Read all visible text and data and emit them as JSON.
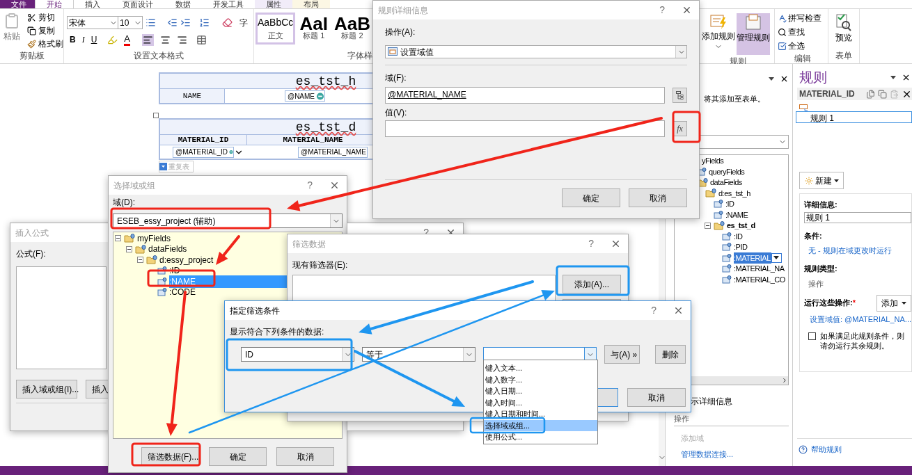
{
  "ribbon": {
    "tabs": [
      {
        "label": "文件",
        "kind": "file",
        "selected": false
      },
      {
        "label": "开始",
        "kind": "tab",
        "selected": true
      },
      {
        "label": "插入",
        "kind": "tab",
        "selected": false
      },
      {
        "label": "页面设计",
        "kind": "tab",
        "selected": false
      },
      {
        "label": "数据",
        "kind": "tab",
        "selected": false
      },
      {
        "label": "开发工具",
        "kind": "tab",
        "selected": false
      },
      {
        "label": "属性",
        "kind": "tab",
        "selected": false,
        "color": "#f1ecf9"
      },
      {
        "label": "布局",
        "kind": "tab",
        "selected": false,
        "color": "#fcf7e4"
      }
    ],
    "clipboard": {
      "paste": "粘贴",
      "cut": "剪切",
      "copy": "复制",
      "painter": "格式刷",
      "label": "剪贴板"
    },
    "format": {
      "font": "宋体",
      "size": "10",
      "bold": "B",
      "italic": "I",
      "underline": "U",
      "font_color": "A",
      "char": "字",
      "label": "设置文本格式"
    },
    "styles": {
      "items": [
        {
          "preview": "AaBbCc",
          "name": "正文",
          "selected": true
        },
        {
          "preview": "AaI",
          "name": "标题 1",
          "selected": false
        },
        {
          "preview": "AaB",
          "name": "标题 2",
          "selected": false
        }
      ],
      "label": "字体样"
    },
    "rules": {
      "add": "添加规则",
      "manage": "管理规则",
      "manage_selected": true,
      "label": "规则"
    },
    "editing": {
      "spell": "拼写检查",
      "find": "查找",
      "select_all": "全选",
      "label": "编辑"
    },
    "form": {
      "preview": "预览",
      "label": "表单"
    }
  },
  "canvas": {
    "header_table": {
      "title": "es_tst_h",
      "label": "NAME",
      "field": "@NAME"
    },
    "repeating_table": {
      "title": "es_tst_d",
      "columns": [
        "MATERIAL_ID",
        "MATERIAL_NAME"
      ],
      "fields": [
        "@MATERIAL_ID",
        "@MATERIAL_NAME"
      ],
      "tag": "重复表"
    }
  },
  "fields_panel": {
    "hint": "将其添加至表单。",
    "tree": [
      {
        "label": "yFields",
        "selected": false,
        "children": [
          {
            "label": "queryFields",
            "selected": false
          },
          {
            "label": "dataFields",
            "selected": false,
            "children": [
              {
                "label": "d:es_tst_h",
                "selected": false,
                "children": [
                  {
                    "label": ":ID",
                    "selected": false
                  },
                  {
                    "label": ":NAME",
                    "selected": false
                  },
                  {
                    "label": "es_tst_d",
                    "selected": false,
                    "bold": true,
                    "expanded": true,
                    "children": [
                      {
                        "label": ":ID",
                        "selected": false
                      },
                      {
                        "label": ":PID",
                        "selected": false
                      },
                      {
                        "label": ":MATERIAL",
                        "selected": true
                      },
                      {
                        "label": ":MATERIAL_NA",
                        "selected": false
                      },
                      {
                        "label": ":MATERIAL_CO",
                        "selected": false
                      }
                    ]
                  }
                ]
              }
            ]
          }
        ]
      }
    ],
    "show_details": "示详细信息",
    "actions_label": "操作",
    "add_field": "添加域",
    "manage": "管理数据连接..."
  },
  "rules_panel": {
    "title": "规则",
    "control": "MATERIAL_ID",
    "rules": [
      {
        "label": "规则 1",
        "selected": true
      }
    ],
    "new": "新建",
    "details_label": "详细信息:",
    "name": "规则 1",
    "condition_label": "条件:",
    "condition": "无 - 规则在域更改时运行",
    "type_label": "规则类型:",
    "type": "操作",
    "actions_label": "运行这些操作:",
    "required": "*",
    "add": "添加",
    "action": "设置域值: @MATERIAL_NA...",
    "stop": {
      "label": "如果满足此规则条件，则请勿运行其余规则。",
      "checked": false
    },
    "help": "帮助规则"
  },
  "insert_formula_dialog": {
    "title": "插入公式",
    "active": false,
    "formula_label": "公式(F):",
    "buttons": [
      "插入域或组(I)...",
      "插入"
    ]
  },
  "select_field_dialog": {
    "title": "选择域或组",
    "help": "?",
    "active": false,
    "source_label": "域(D):",
    "source": "ESEB_essy_project (辅助)",
    "tree": [
      {
        "label": "myFields",
        "selected": false,
        "expanded": true,
        "children": [
          {
            "label": "dataFields",
            "selected": false,
            "expanded": true,
            "children": [
              {
                "label": "d:essy_project",
                "selected": false,
                "expanded": true,
                "children": [
                  {
                    "label": ":ID",
                    "selected": false
                  },
                  {
                    "label": ":NAME",
                    "selected": true
                  },
                  {
                    "label": ":CODE",
                    "selected": false
                  }
                ]
              }
            ]
          }
        ]
      }
    ],
    "buttons": [
      "筛选数据(F)...",
      "确定",
      "取消"
    ]
  },
  "hidden_dialog": {
    "help": "?"
  },
  "filter_dialog": {
    "title": "筛选数据",
    "help": "?",
    "active": false,
    "list_label": "现有筛选器(E):",
    "add": "添加(A)..."
  },
  "condition_dialog": {
    "title": "指定筛选条件",
    "help": "?",
    "active": true,
    "prompt": "显示符合下列条件的数据:",
    "field": "ID",
    "operator": "等于",
    "and": "与(A) »",
    "delete": "删除",
    "cancel": "取消",
    "options": [
      {
        "label": "键入文本...",
        "selected": false
      },
      {
        "label": "键入数字...",
        "selected": false
      },
      {
        "label": "键入日期...",
        "selected": false
      },
      {
        "label": "键入时间...",
        "selected": false
      },
      {
        "label": "键入日期和时间...",
        "selected": false
      },
      {
        "label": "选择域或组...",
        "selected": true
      },
      {
        "label": "使用公式...",
        "selected": false
      }
    ]
  },
  "rule_details_dialog": {
    "title": "规则详细信息",
    "help": "?",
    "active": false,
    "action_label": "操作(A):",
    "action": "设置域值",
    "field_label": "域(F):",
    "field": "@MATERIAL_NAME",
    "value_label": "值(V):",
    "value_button": "fx",
    "ok": "确定",
    "cancel": "取消"
  }
}
